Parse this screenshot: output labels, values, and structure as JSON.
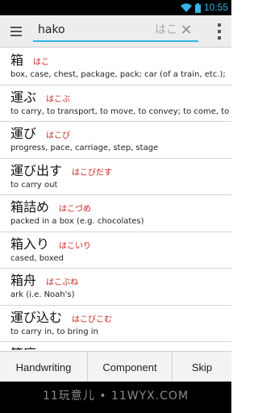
{
  "status": {
    "time": "10:55"
  },
  "search": {
    "value": "hako",
    "kana": "はこ",
    "clear": "×"
  },
  "results": [
    {
      "kanji": "箱",
      "reading": "はこ",
      "gloss": "box, case, chest, package, pack; car (of a train, etc.);"
    },
    {
      "kanji": "運ぶ",
      "reading": "はこぶ",
      "gloss": "to carry, to transport, to move, to convey; to come, to"
    },
    {
      "kanji": "運び",
      "reading": "はこび",
      "gloss": "progress, pace, carriage, step, stage"
    },
    {
      "kanji": "運び出す",
      "reading": "はこびだす",
      "gloss": "to carry out"
    },
    {
      "kanji": "箱詰め",
      "reading": "はこづめ",
      "gloss": "packed in a box (e.g. chocolates)"
    },
    {
      "kanji": "箱入り",
      "reading": "はこいり",
      "gloss": "cased, boxed"
    },
    {
      "kanji": "箱舟",
      "reading": "はこぶね",
      "gloss": "ark (i.e. Noah's)"
    },
    {
      "kanji": "運び込む",
      "reading": "はこびこむ",
      "gloss": "to carry in, to bring in"
    },
    {
      "kanji": "箱庭",
      "reading": "",
      "gloss": ""
    }
  ],
  "buttons": {
    "handwriting": "Handwriting",
    "component": "Component",
    "skip": "Skip"
  },
  "watermark": "11玩意儿 • 11WYX.COM",
  "colors": {
    "accent": "#33b5e5",
    "reading": "#c8201a"
  }
}
